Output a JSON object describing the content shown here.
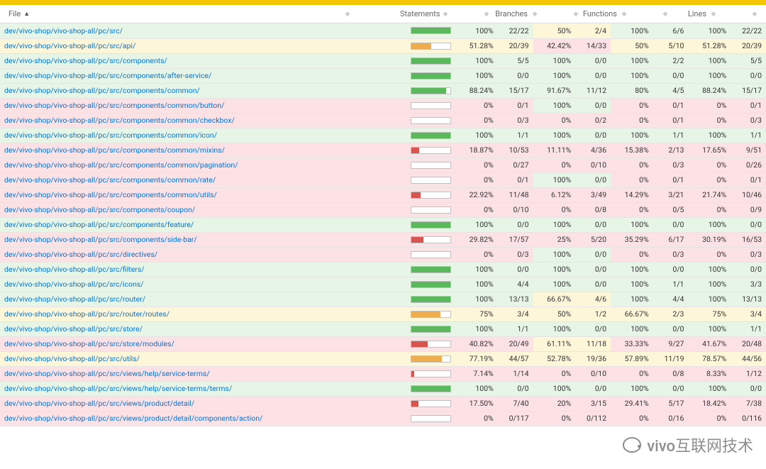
{
  "watermark_text": "vivo互联网技术",
  "headers": {
    "file": "File",
    "statements": "Statements",
    "branches": "Branches",
    "functions": "Functions",
    "lines": "Lines"
  },
  "chart_data": {
    "type": "table",
    "title": "Code coverage report",
    "columns": [
      "File",
      "Statements %",
      "Statements",
      "Branches %",
      "Branches",
      "Functions %",
      "Functions",
      "Lines %",
      "Lines"
    ],
    "rows": [
      {
        "file": "dev/vivo-shop/vivo-shop-all/pc/src/",
        "sp": 100,
        "sf": "22/22",
        "bp": 50,
        "bf": "2/4",
        "fp": 100,
        "ff": "6/6",
        "lp": 100,
        "lf": "22/22"
      },
      {
        "file": "dev/vivo-shop/vivo-shop-all/pc/src/api/",
        "sp": 51.28,
        "sf": "20/39",
        "bp": 42.42,
        "bf": "14/33",
        "fp": 50,
        "ff": "5/10",
        "lp": 51.28,
        "lf": "20/39"
      },
      {
        "file": "dev/vivo-shop/vivo-shop-all/pc/src/components/",
        "sp": 100,
        "sf": "5/5",
        "bp": 100,
        "bf": "0/0",
        "fp": 100,
        "ff": "2/2",
        "lp": 100,
        "lf": "5/5"
      },
      {
        "file": "dev/vivo-shop/vivo-shop-all/pc/src/components/after-service/",
        "sp": 100,
        "sf": "0/0",
        "bp": 100,
        "bf": "0/0",
        "fp": 100,
        "ff": "0/0",
        "lp": 100,
        "lf": "0/0"
      },
      {
        "file": "dev/vivo-shop/vivo-shop-all/pc/src/components/common/",
        "sp": 88.24,
        "sf": "15/17",
        "bp": 91.67,
        "bf": "11/12",
        "fp": 80,
        "ff": "4/5",
        "lp": 88.24,
        "lf": "15/17"
      },
      {
        "file": "dev/vivo-shop/vivo-shop-all/pc/src/components/common/button/",
        "sp": 0,
        "sf": "0/1",
        "bp": 100,
        "bf": "0/0",
        "fp": 0,
        "ff": "0/1",
        "lp": 0,
        "lf": "0/1"
      },
      {
        "file": "dev/vivo-shop/vivo-shop-all/pc/src/components/common/checkbox/",
        "sp": 0,
        "sf": "0/3",
        "bp": 0,
        "bf": "0/2",
        "fp": 0,
        "ff": "0/1",
        "lp": 0,
        "lf": "0/3"
      },
      {
        "file": "dev/vivo-shop/vivo-shop-all/pc/src/components/common/icon/",
        "sp": 100,
        "sf": "1/1",
        "bp": 100,
        "bf": "0/0",
        "fp": 100,
        "ff": "1/1",
        "lp": 100,
        "lf": "1/1"
      },
      {
        "file": "dev/vivo-shop/vivo-shop-all/pc/src/components/common/mixins/",
        "sp": 18.87,
        "sf": "10/53",
        "bp": 11.11,
        "bf": "4/36",
        "fp": 15.38,
        "ff": "2/13",
        "lp": 17.65,
        "lf": "9/51"
      },
      {
        "file": "dev/vivo-shop/vivo-shop-all/pc/src/components/common/pagination/",
        "sp": 0,
        "sf": "0/27",
        "bp": 0,
        "bf": "0/10",
        "fp": 0,
        "ff": "0/3",
        "lp": 0,
        "lf": "0/26"
      },
      {
        "file": "dev/vivo-shop/vivo-shop-all/pc/src/components/common/rate/",
        "sp": 0,
        "sf": "0/1",
        "bp": 100,
        "bf": "0/0",
        "fp": 0,
        "ff": "0/1",
        "lp": 0,
        "lf": "0/1"
      },
      {
        "file": "dev/vivo-shop/vivo-shop-all/pc/src/components/common/utils/",
        "sp": 22.92,
        "sf": "11/48",
        "bp": 6.12,
        "bf": "3/49",
        "fp": 14.29,
        "ff": "3/21",
        "lp": 21.74,
        "lf": "10/46"
      },
      {
        "file": "dev/vivo-shop/vivo-shop-all/pc/src/components/coupon/",
        "sp": 0,
        "sf": "0/10",
        "bp": 0,
        "bf": "0/8",
        "fp": 0,
        "ff": "0/5",
        "lp": 0,
        "lf": "0/9"
      },
      {
        "file": "dev/vivo-shop/vivo-shop-all/pc/src/components/feature/",
        "sp": 100,
        "sf": "0/0",
        "bp": 100,
        "bf": "0/0",
        "fp": 100,
        "ff": "0/0",
        "lp": 100,
        "lf": "0/0"
      },
      {
        "file": "dev/vivo-shop/vivo-shop-all/pc/src/components/side-bar/",
        "sp": 29.82,
        "sf": "17/57",
        "bp": 25,
        "bf": "5/20",
        "fp": 35.29,
        "ff": "6/17",
        "lp": 30.19,
        "lf": "16/53"
      },
      {
        "file": "dev/vivo-shop/vivo-shop-all/pc/src/directives/",
        "sp": 0,
        "sf": "0/3",
        "bp": 100,
        "bf": "0/0",
        "fp": 0,
        "ff": "0/3",
        "lp": 0,
        "lf": "0/3"
      },
      {
        "file": "dev/vivo-shop/vivo-shop-all/pc/src/filters/",
        "sp": 100,
        "sf": "0/0",
        "bp": 100,
        "bf": "0/0",
        "fp": 100,
        "ff": "0/0",
        "lp": 100,
        "lf": "0/0"
      },
      {
        "file": "dev/vivo-shop/vivo-shop-all/pc/src/icons/",
        "sp": 100,
        "sf": "4/4",
        "bp": 100,
        "bf": "0/0",
        "fp": 100,
        "ff": "1/1",
        "lp": 100,
        "lf": "3/3"
      },
      {
        "file": "dev/vivo-shop/vivo-shop-all/pc/src/router/",
        "sp": 100,
        "sf": "13/13",
        "bp": 66.67,
        "bf": "4/6",
        "fp": 100,
        "ff": "4/4",
        "lp": 100,
        "lf": "13/13"
      },
      {
        "file": "dev/vivo-shop/vivo-shop-all/pc/src/router/routes/",
        "sp": 75,
        "sf": "3/4",
        "bp": 50,
        "bf": "1/2",
        "fp": 66.67,
        "ff": "2/3",
        "lp": 75,
        "lf": "3/4"
      },
      {
        "file": "dev/vivo-shop/vivo-shop-all/pc/src/store/",
        "sp": 100,
        "sf": "1/1",
        "bp": 100,
        "bf": "0/0",
        "fp": 100,
        "ff": "0/0",
        "lp": 100,
        "lf": "1/1"
      },
      {
        "file": "dev/vivo-shop/vivo-shop-all/pc/src/store/modules/",
        "sp": 40.82,
        "sf": "20/49",
        "bp": 61.11,
        "bf": "11/18",
        "fp": 33.33,
        "ff": "9/27",
        "lp": 41.67,
        "lf": "20/48"
      },
      {
        "file": "dev/vivo-shop/vivo-shop-all/pc/src/utils/",
        "sp": 77.19,
        "sf": "44/57",
        "bp": 52.78,
        "bf": "19/36",
        "fp": 57.89,
        "ff": "11/19",
        "lp": 78.57,
        "lf": "44/56"
      },
      {
        "file": "dev/vivo-shop/vivo-shop-all/pc/src/views/help/service-terms/",
        "sp": 7.14,
        "sf": "1/14",
        "bp": 0,
        "bf": "0/10",
        "fp": 0,
        "ff": "0/8",
        "lp": 8.33,
        "lf": "1/12"
      },
      {
        "file": "dev/vivo-shop/vivo-shop-all/pc/src/views/help/service-terms/terms/",
        "sp": 100,
        "sf": "0/0",
        "bp": 100,
        "bf": "0/0",
        "fp": 100,
        "ff": "0/0",
        "lp": 100,
        "lf": "0/0"
      },
      {
        "file": "dev/vivo-shop/vivo-shop-all/pc/src/views/product/detail/",
        "sp": 17.5,
        "sf": "7/40",
        "bp": 20,
        "bf": "3/15",
        "fp": 29.41,
        "ff": "5/17",
        "lp": 18.42,
        "lf": "7/38"
      },
      {
        "file": "dev/vivo-shop/vivo-shop-all/pc/src/views/product/detail/components/action/",
        "sp": 0,
        "sf": "0/117",
        "bp": 0,
        "bf": "0/112",
        "fp": 0,
        "ff": "0/16",
        "lp": 0,
        "lf": "0/116"
      }
    ]
  }
}
